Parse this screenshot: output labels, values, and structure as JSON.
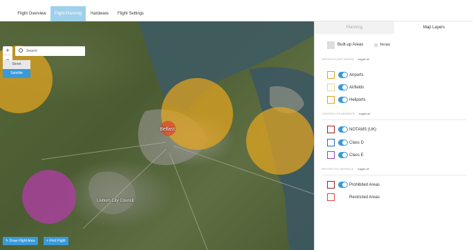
{
  "nav": {
    "tabs": [
      {
        "label": "Flight Overview"
      },
      {
        "label": "Flight Planning"
      },
      {
        "label": "Hardware"
      },
      {
        "label": "Flight Settings"
      }
    ],
    "active": 1
  },
  "map": {
    "search_placeholder": "Search",
    "zoom_in": "+",
    "zoom_out": "−",
    "reset": "⊙",
    "map_types": [
      "Street",
      "Satellite"
    ],
    "active_type": "Satellite",
    "labels": {
      "city": "Belfast",
      "council": "Lisburn City Council"
    },
    "buttons": {
      "draw": "Draw Flight Area",
      "find": "Find Flight"
    }
  },
  "panel": {
    "tabs": [
      "Planning",
      "Map Layers"
    ],
    "active_tab": "Map Layers",
    "built_up": "Built-up Areas",
    "terrain": "Terrain",
    "sections": [
      {
        "title": "AIRFIELDS (RAF BASES)",
        "toggle": "toggle all",
        "items": [
          {
            "label": "Airports",
            "color": "#e0a020"
          },
          {
            "label": "Airfields",
            "color": "#e0a020"
          },
          {
            "label": "Heliports",
            "color": "#e0a020"
          }
        ]
      },
      {
        "title": "CONTROLLED AIRSPACE",
        "toggle": "toggle all",
        "items": [
          {
            "label": "NOTAMS (UK)",
            "color": "#9b1c1c"
          },
          {
            "label": "Class D",
            "color": "#1f6fb5"
          },
          {
            "label": "Class E",
            "color": "#9b3fb5"
          }
        ]
      },
      {
        "title": "RESTRICTED AIRSPACE",
        "toggle": "toggle all",
        "items": [
          {
            "label": "Prohibited Areas",
            "color": "#9b1c1c"
          },
          {
            "label": "Restricted Areas",
            "color": "#e04040"
          }
        ]
      }
    ]
  }
}
